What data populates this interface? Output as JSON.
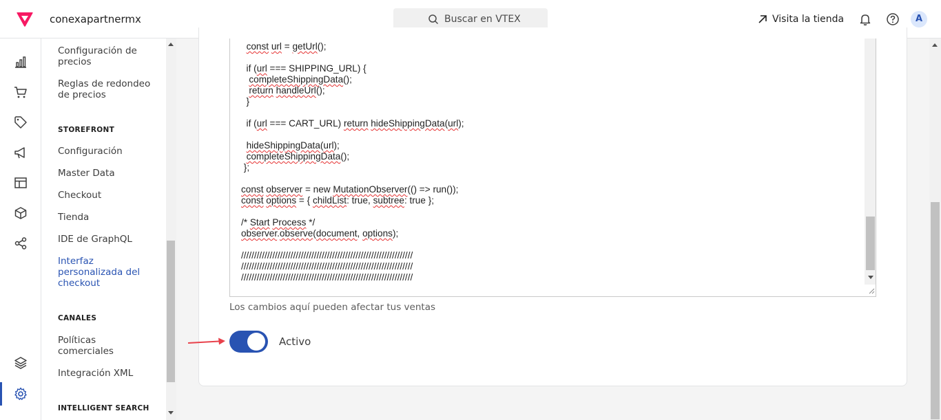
{
  "header": {
    "account_name": "conexapartnermx",
    "search_label": "Buscar en VTEX",
    "visit_store_label": "Visita la tienda",
    "avatar_initial": "A"
  },
  "colors": {
    "brand": "#f71963",
    "accent": "#2953b2",
    "arrow": "#e8414b"
  },
  "rail": {
    "icons": [
      "chart-icon",
      "cart-icon",
      "tag-icon",
      "megaphone-icon",
      "layout-icon",
      "box-icon",
      "share-icon",
      "layers-icon",
      "gear-icon"
    ],
    "active": "gear-icon"
  },
  "subnav": {
    "items_pricing": [
      {
        "label": "Configuración de precios"
      },
      {
        "label": "Reglas de redondeo de precios"
      }
    ],
    "section_storefront": "STOREFRONT",
    "items_storefront": [
      {
        "label": "Configuración"
      },
      {
        "label": "Master Data"
      },
      {
        "label": "Checkout"
      },
      {
        "label": "Tienda"
      },
      {
        "label": "IDE de GraphQL"
      },
      {
        "label": "Interfaz personalizada del checkout",
        "active": true
      }
    ],
    "section_channels": "CANALES",
    "items_channels": [
      {
        "label": "Políticas comerciales"
      },
      {
        "label": "Integración XML"
      }
    ],
    "section_search": "INTELLIGENT SEARCH"
  },
  "editor": {
    "lines": [
      "  const url = getUrl();",
      "",
      "  if (url === SHIPPING_URL) {",
      "   completeShippingData();",
      "   return handleUrl();",
      "  }",
      "",
      "  if (url === CART_URL) return hideShippingData(url);",
      "",
      "  hideShippingData(url);",
      "  completeShippingData();",
      " };",
      "",
      "const observer = new MutationObserver(() => run());",
      "const options = { childList: true, subtree: true };",
      "",
      "/* Start Process */",
      "observer.observe(document, options);",
      "",
      "//////////////////////////////////////////////////////////////////",
      "//////////////////////////////////////////////////////////////////",
      "//////////////////////////////////////////////////////////////////"
    ],
    "helper_text": "Los cambios aquí pueden afectar tus ventas"
  },
  "toggle": {
    "label": "Activo",
    "on": true
  }
}
